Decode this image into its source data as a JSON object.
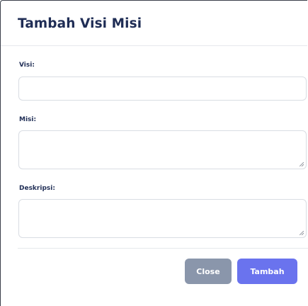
{
  "modal": {
    "title": "Tambah Visi Misi"
  },
  "form": {
    "visi_label": "Visi:",
    "visi_value": "",
    "misi_label": "Misi:",
    "misi_value": "",
    "deskripsi_label": "Deskripsi:",
    "deskripsi_value": ""
  },
  "footer": {
    "close_label": "Close",
    "add_label": "Tambah"
  },
  "colors": {
    "title_text": "#1f2d55",
    "close_button": "#8a96ab",
    "add_button": "#6a73ee"
  }
}
